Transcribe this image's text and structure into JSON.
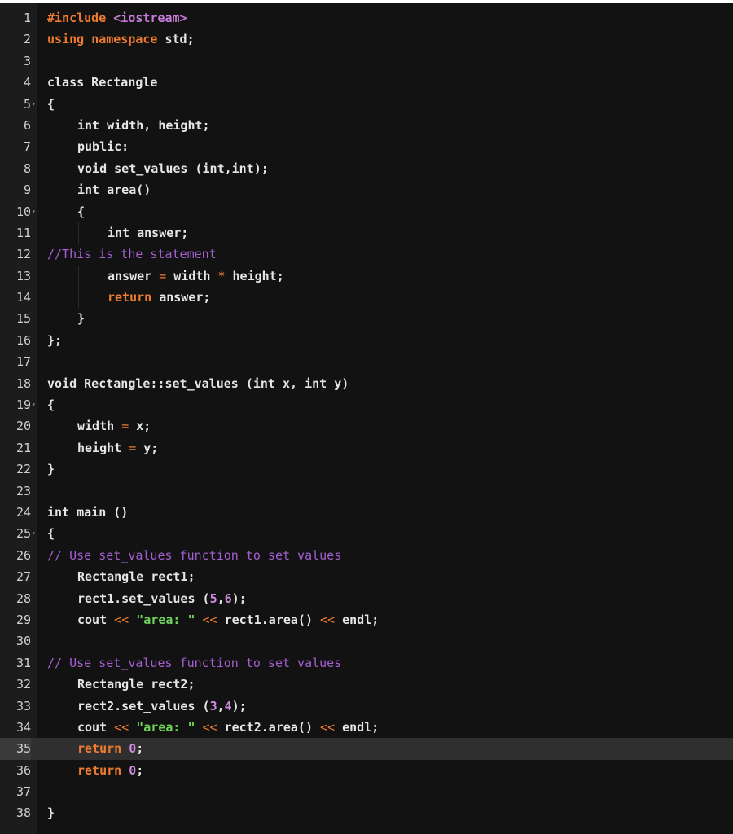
{
  "editor": {
    "active_line": 35,
    "colors": {
      "background": "#121212",
      "gutter": "#1c1c1c",
      "active_line": "#2f2f2f",
      "keyword": "#ef7b2f",
      "comment": "#a45fd1",
      "string": "#6fd45a",
      "number": "#d08de0"
    },
    "lines": [
      {
        "n": "1",
        "fold": false,
        "indent": 0,
        "tokens": [
          [
            "pp",
            "#include "
          ],
          [
            "inc",
            "<iostream>"
          ]
        ]
      },
      {
        "n": "2",
        "fold": false,
        "indent": 0,
        "tokens": [
          [
            "kw",
            "using"
          ],
          [
            "txt",
            " "
          ],
          [
            "kw",
            "namespace"
          ],
          [
            "txt",
            " std;"
          ]
        ]
      },
      {
        "n": "3",
        "fold": false,
        "indent": 0,
        "tokens": []
      },
      {
        "n": "4",
        "fold": false,
        "indent": 0,
        "tokens": [
          [
            "txt",
            "class Rectangle"
          ]
        ]
      },
      {
        "n": "5",
        "fold": true,
        "indent": 0,
        "tokens": [
          [
            "txt",
            "{"
          ]
        ]
      },
      {
        "n": "6",
        "fold": false,
        "indent": 1,
        "tokens": [
          [
            "txt",
            "int width, height;"
          ]
        ]
      },
      {
        "n": "7",
        "fold": false,
        "indent": 1,
        "tokens": [
          [
            "txt",
            "public:"
          ]
        ]
      },
      {
        "n": "8",
        "fold": false,
        "indent": 1,
        "tokens": [
          [
            "txt",
            "void set_values (int,int);"
          ]
        ]
      },
      {
        "n": "9",
        "fold": false,
        "indent": 1,
        "tokens": [
          [
            "txt",
            "int area()"
          ]
        ]
      },
      {
        "n": "10",
        "fold": true,
        "indent": 1,
        "tokens": [
          [
            "txt",
            "{"
          ]
        ]
      },
      {
        "n": "11",
        "fold": false,
        "indent": 2,
        "tokens": [
          [
            "txt",
            "int answer;"
          ]
        ]
      },
      {
        "n": "12",
        "fold": false,
        "indent": 0,
        "tokens": [
          [
            "cm",
            "//This is the statement"
          ]
        ]
      },
      {
        "n": "13",
        "fold": false,
        "indent": 2,
        "tokens": [
          [
            "txt",
            "answer "
          ],
          [
            "op",
            "="
          ],
          [
            "txt",
            " width "
          ],
          [
            "op",
            "*"
          ],
          [
            "txt",
            " height;"
          ]
        ]
      },
      {
        "n": "14",
        "fold": false,
        "indent": 2,
        "tokens": [
          [
            "kw",
            "return"
          ],
          [
            "txt",
            " answer;"
          ]
        ]
      },
      {
        "n": "15",
        "fold": false,
        "indent": 1,
        "tokens": [
          [
            "txt",
            "}"
          ]
        ]
      },
      {
        "n": "16",
        "fold": false,
        "indent": 0,
        "tokens": [
          [
            "txt",
            "};"
          ]
        ]
      },
      {
        "n": "17",
        "fold": false,
        "indent": 0,
        "tokens": []
      },
      {
        "n": "18",
        "fold": false,
        "indent": 0,
        "tokens": [
          [
            "txt",
            "void Rectangle::set_values (int x, int y)"
          ]
        ]
      },
      {
        "n": "19",
        "fold": true,
        "indent": 0,
        "tokens": [
          [
            "txt",
            "{"
          ]
        ]
      },
      {
        "n": "20",
        "fold": false,
        "indent": 1,
        "tokens": [
          [
            "txt",
            "width "
          ],
          [
            "op",
            "="
          ],
          [
            "txt",
            " x;"
          ]
        ]
      },
      {
        "n": "21",
        "fold": false,
        "indent": 1,
        "tokens": [
          [
            "txt",
            "height "
          ],
          [
            "op",
            "="
          ],
          [
            "txt",
            " y;"
          ]
        ]
      },
      {
        "n": "22",
        "fold": false,
        "indent": 0,
        "tokens": [
          [
            "txt",
            "}"
          ]
        ]
      },
      {
        "n": "23",
        "fold": false,
        "indent": 0,
        "tokens": []
      },
      {
        "n": "24",
        "fold": false,
        "indent": 0,
        "tokens": [
          [
            "txt",
            "int main ()"
          ]
        ]
      },
      {
        "n": "25",
        "fold": true,
        "indent": 0,
        "tokens": [
          [
            "txt",
            "{"
          ]
        ]
      },
      {
        "n": "26",
        "fold": false,
        "indent": 0,
        "tokens": [
          [
            "cm",
            "// Use set_values function to set values"
          ]
        ]
      },
      {
        "n": "27",
        "fold": false,
        "indent": 1,
        "tokens": [
          [
            "txt",
            "Rectangle rect1;"
          ]
        ]
      },
      {
        "n": "28",
        "fold": false,
        "indent": 1,
        "tokens": [
          [
            "txt",
            "rect1.set_values ("
          ],
          [
            "num",
            "5"
          ],
          [
            "txt",
            ","
          ],
          [
            "num",
            "6"
          ],
          [
            "txt",
            ");"
          ]
        ]
      },
      {
        "n": "29",
        "fold": false,
        "indent": 1,
        "tokens": [
          [
            "txt",
            "cout "
          ],
          [
            "op",
            "<<"
          ],
          [
            "txt",
            " "
          ],
          [
            "str",
            "\"area: \""
          ],
          [
            "txt",
            " "
          ],
          [
            "op",
            "<<"
          ],
          [
            "txt",
            " rect1.area() "
          ],
          [
            "op",
            "<<"
          ],
          [
            "txt",
            " endl;"
          ]
        ]
      },
      {
        "n": "30",
        "fold": false,
        "indent": 0,
        "tokens": []
      },
      {
        "n": "31",
        "fold": false,
        "indent": 0,
        "tokens": [
          [
            "cm",
            "// Use set_values function to set values"
          ]
        ]
      },
      {
        "n": "32",
        "fold": false,
        "indent": 1,
        "tokens": [
          [
            "txt",
            "Rectangle rect2;"
          ]
        ]
      },
      {
        "n": "33",
        "fold": false,
        "indent": 1,
        "tokens": [
          [
            "txt",
            "rect2.set_values ("
          ],
          [
            "num",
            "3"
          ],
          [
            "txt",
            ","
          ],
          [
            "num",
            "4"
          ],
          [
            "txt",
            ");"
          ]
        ]
      },
      {
        "n": "34",
        "fold": false,
        "indent": 1,
        "tokens": [
          [
            "txt",
            "cout "
          ],
          [
            "op",
            "<<"
          ],
          [
            "txt",
            " "
          ],
          [
            "str",
            "\"area: \""
          ],
          [
            "txt",
            " "
          ],
          [
            "op",
            "<<"
          ],
          [
            "txt",
            " rect2.area() "
          ],
          [
            "op",
            "<<"
          ],
          [
            "txt",
            " endl;"
          ]
        ]
      },
      {
        "n": "35",
        "fold": false,
        "indent": 1,
        "tokens": [
          [
            "kw",
            "return"
          ],
          [
            "txt",
            " "
          ],
          [
            "num",
            "0"
          ],
          [
            "txt",
            ";"
          ]
        ]
      },
      {
        "n": "36",
        "fold": false,
        "indent": 1,
        "tokens": [
          [
            "kw",
            "return"
          ],
          [
            "txt",
            " "
          ],
          [
            "num",
            "0"
          ],
          [
            "txt",
            ";"
          ]
        ]
      },
      {
        "n": "37",
        "fold": false,
        "indent": 0,
        "tokens": []
      },
      {
        "n": "38",
        "fold": false,
        "indent": 0,
        "tokens": [
          [
            "txt",
            "}"
          ]
        ]
      }
    ]
  }
}
